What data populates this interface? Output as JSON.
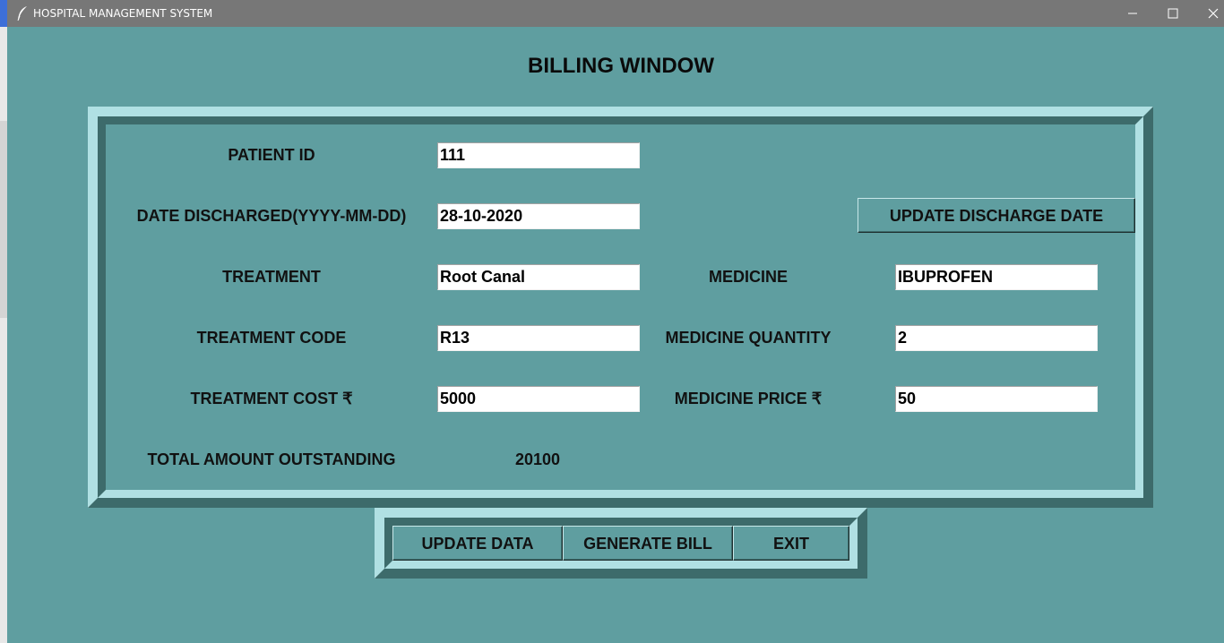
{
  "window": {
    "title": "HOSPITAL MANAGEMENT SYSTEM",
    "icon": "feather-icon"
  },
  "heading": "BILLING WINDOW",
  "form": {
    "patient_id": {
      "label": "PATIENT ID",
      "value": "111"
    },
    "date_discharged": {
      "label": "DATE DISCHARGED(YYYY-MM-DD)",
      "value": "28-10-2020"
    },
    "update_discharge_button": "UPDATE DISCHARGE DATE",
    "treatment": {
      "label": "TREATMENT",
      "value": "Root Canal"
    },
    "medicine": {
      "label": "MEDICINE",
      "value": "IBUPROFEN"
    },
    "treatment_code": {
      "label": "TREATMENT CODE",
      "value": "R13"
    },
    "medicine_quantity": {
      "label": "MEDICINE QUANTITY",
      "value": "2"
    },
    "treatment_cost": {
      "label": "TREATMENT COST ₹",
      "value": "5000"
    },
    "medicine_price": {
      "label": "MEDICINE PRICE ₹",
      "value": "50"
    },
    "total": {
      "label": "TOTAL AMOUNT OUTSTANDING",
      "value": "20100"
    }
  },
  "actions": {
    "update_data": "UPDATE DATA",
    "generate_bill": "GENERATE BILL",
    "exit": "EXIT"
  },
  "colors": {
    "background": "#5f9ea0",
    "ridge_light": "#b0e0e3",
    "ridge_dark": "#3d6b6b",
    "titlebar": "#777777"
  }
}
